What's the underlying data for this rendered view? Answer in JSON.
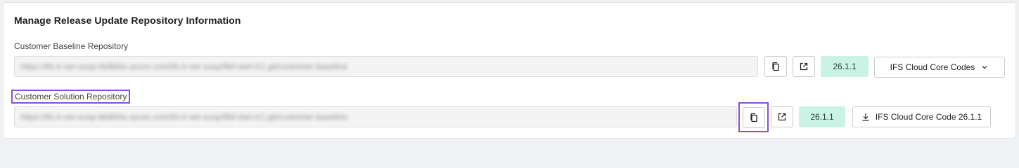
{
  "section": {
    "title": "Manage Release Update Repository Information"
  },
  "baseline": {
    "label": "Customer Baseline Repository",
    "url": "https://ifs-lr-we-susp-bb8b0e.azure.com/ifs-lr-we-susp/6bf-dart-tr1.git/customer-baseline",
    "version": "26.1.1",
    "codes_select": "IFS Cloud Core Codes"
  },
  "solution": {
    "label": "Customer Solution Repository",
    "url": "https://ifs-lr-we-susp-bb8b0e.azure.com/ifs-lr-we-susp/6bf-dart-tr1.git/customer-baseline",
    "version": "26.1.1",
    "download_label": "IFS Cloud Core Code 26.1.1"
  },
  "icons": {
    "copy": "copy-icon",
    "open": "external-link-icon",
    "chevron": "chevron-down-icon",
    "download": "download-icon"
  },
  "colors": {
    "highlight": "#8a4fd6",
    "version_badge_bg": "#c9f3e4"
  }
}
